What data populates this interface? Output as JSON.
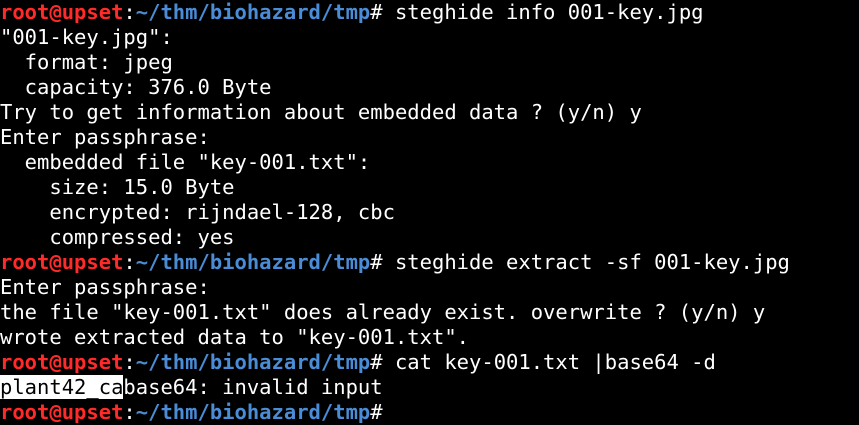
{
  "prompt": {
    "user": "root@upset",
    "sep": ":",
    "path": "~/thm/biohazard/tmp",
    "symbol": "#"
  },
  "lines": [
    {
      "type": "cmd",
      "text": " steghide info 001-key.jpg"
    },
    {
      "type": "out",
      "text": "\"001-key.jpg\":"
    },
    {
      "type": "out",
      "text": "  format: jpeg"
    },
    {
      "type": "out",
      "text": "  capacity: 376.0 Byte"
    },
    {
      "type": "out",
      "text": "Try to get information about embedded data ? (y/n) y"
    },
    {
      "type": "out",
      "text": "Enter passphrase:"
    },
    {
      "type": "out",
      "text": "  embedded file \"key-001.txt\":"
    },
    {
      "type": "out",
      "text": "    size: 15.0 Byte"
    },
    {
      "type": "out",
      "text": "    encrypted: rijndael-128, cbc"
    },
    {
      "type": "out",
      "text": "    compressed: yes"
    },
    {
      "type": "cmd",
      "text": " steghide extract -sf 001-key.jpg"
    },
    {
      "type": "out",
      "text": "Enter passphrase:"
    },
    {
      "type": "out",
      "text": "the file \"key-001.txt\" does already exist. overwrite ? (y/n) y"
    },
    {
      "type": "out",
      "text": "wrote extracted data to \"key-001.txt\"."
    },
    {
      "type": "cmd",
      "text": " cat key-001.txt |base64 -d"
    },
    {
      "type": "hlout",
      "highlight": "plant42_ca",
      "text": "base64: invalid input"
    },
    {
      "type": "cmd",
      "text": ""
    }
  ],
  "colors": {
    "background": "#000000",
    "user": "#ff2a2a",
    "path": "#4a8cd6",
    "text": "#ffffff"
  }
}
